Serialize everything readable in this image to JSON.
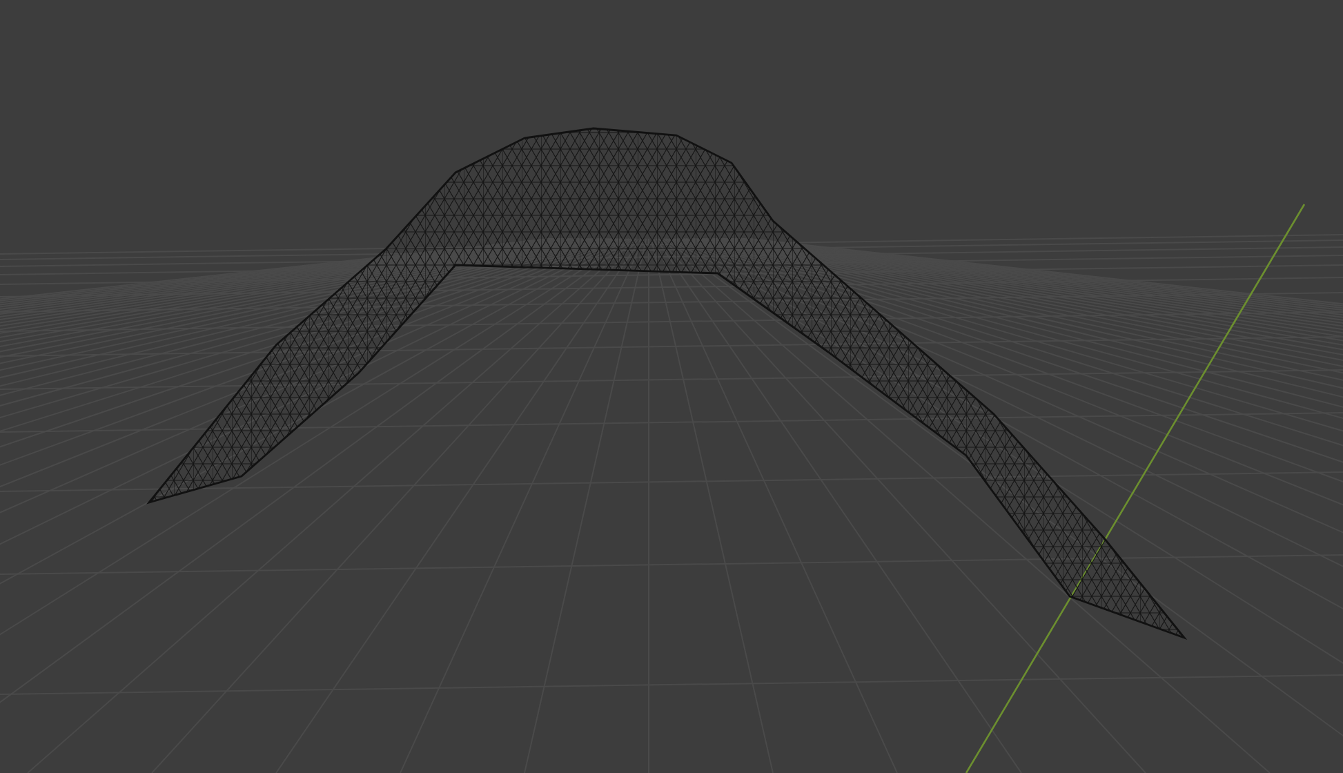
{
  "scene": {
    "kind": "wireframe-mesh"
  }
}
